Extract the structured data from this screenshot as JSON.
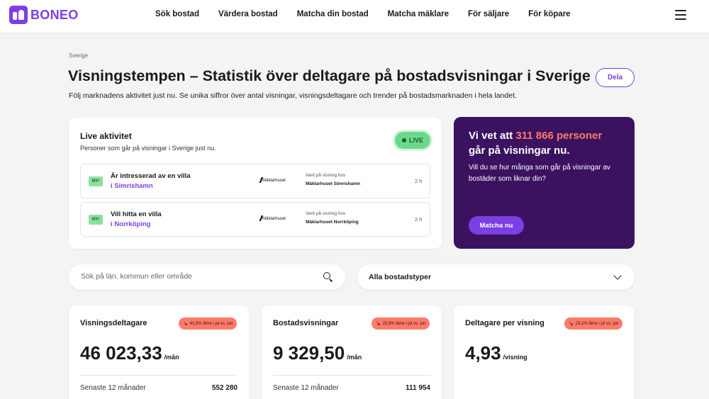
{
  "brand": {
    "name": "BONEO"
  },
  "nav": [
    "Sök bostad",
    "Värdera bostad",
    "Matcha din bostad",
    "Matcha mäklare",
    "För säljare",
    "För köpare"
  ],
  "breadcrumb": "Sverige",
  "page": {
    "title": "Visningstempen – Statistik över deltagare på bostadsvisningar i Sverige",
    "subtitle": "Följ marknadens aktivitet just nu. Se unika siffror över antal visningar, visningsdeltagare och trender på bostadsmarknaden i hela landet.",
    "share_label": "Dela"
  },
  "live": {
    "title": "Live aktivitet",
    "description": "Personer som går på visningar i Sverige just nu.",
    "badge": "LIVE",
    "items": [
      {
        "badge": "NY!",
        "text": "Är intresserad av en villa",
        "location": "i Simrishamn",
        "broker_logo": "Mäklarhuset",
        "visit_label": "Varit på visning hos",
        "broker": "Mäklarhuset Simrishamn",
        "time": "2 h"
      },
      {
        "badge": "NY!",
        "text": "Vill hitta en villa",
        "location": "i Norrköping",
        "broker_logo": "Mäklarhuset",
        "visit_label": "Varit på visning hos",
        "broker": "Mäklarhuset Norrköping",
        "time": "2 h"
      }
    ]
  },
  "promo": {
    "title_prefix": "Vi vet att ",
    "title_highlight": "311 866 personer",
    "title_suffix": "går på visningar nu.",
    "text": "Vill du se hur många som går på visningar av bostäder som liknar din?",
    "button": "Matcha nu",
    "highlight_color": "#ff7a6b",
    "background_color": "#3b1260"
  },
  "search": {
    "placeholder": "Sök på län, kommun eller område"
  },
  "type_select": {
    "selected": "Alla bostadstyper"
  },
  "stats": [
    {
      "title": "Visningsdeltagare",
      "trend": "41,5% färre i jul vs. jun",
      "value": "46 023,33",
      "unit": "/mån",
      "footer_label": "Senaste 12 månader",
      "footer_value": "552 280"
    },
    {
      "title": "Bostadsvisningar",
      "trend": "23,9% färre i jul vs. jun",
      "value": "9 329,50",
      "unit": "/mån",
      "footer_label": "Senaste 12 månader",
      "footer_value": "111 954"
    },
    {
      "title": "Deltagare per visning",
      "trend": "23,1% färre i jul vs. jun",
      "value": "4,93",
      "unit": "/visning"
    }
  ],
  "colors": {
    "accent": "#7b3fe4",
    "live": "#6cd98a",
    "trend_down": "#ff7a6b"
  }
}
